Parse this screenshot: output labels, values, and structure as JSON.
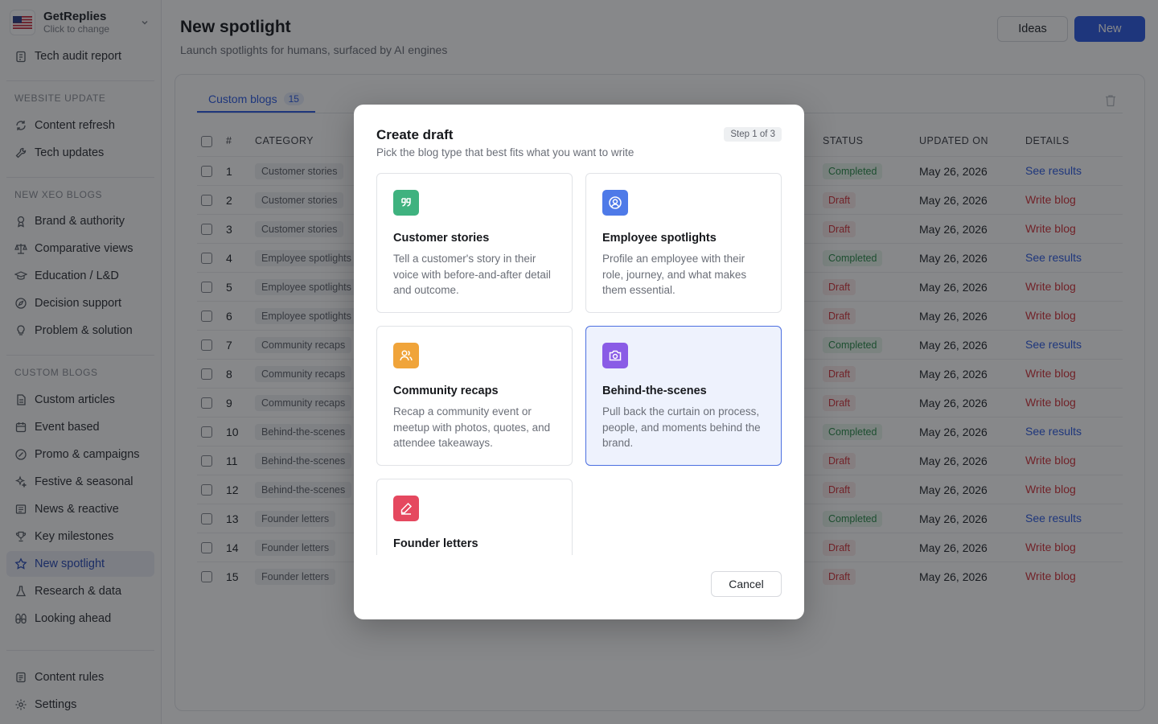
{
  "workspace": {
    "name": "GetReplies",
    "sub": "Click to change"
  },
  "sidebar": {
    "top_item": "Tech audit report",
    "sections": [
      {
        "title": "WEBSITE UPDATE",
        "items": [
          "Content refresh",
          "Tech updates"
        ]
      },
      {
        "title": "NEW XEO BLOGS",
        "items": [
          "Brand & authority",
          "Comparative views",
          "Education / L&D",
          "Decision support",
          "Problem & solution"
        ]
      },
      {
        "title": "CUSTOM BLOGS",
        "items": [
          "Custom articles",
          "Event based",
          "Promo & campaigns",
          "Festive & seasonal",
          "News & reactive",
          "Key milestones",
          "New spotlight",
          "Research & data",
          "Looking ahead"
        ]
      }
    ],
    "footer": [
      "Content rules",
      "Settings"
    ],
    "active": "New spotlight"
  },
  "header": {
    "title": "New spotlight",
    "subtitle": "Launch spotlights for humans, surfaced by AI engines",
    "ideas_label": "Ideas",
    "new_label": "New"
  },
  "tabs": [
    {
      "label": "Custom blogs",
      "count": "15"
    }
  ],
  "table": {
    "columns": {
      "num": "#",
      "category": "CATEGORY",
      "status": "STATUS",
      "updated": "UPDATED ON",
      "details": "DETAILS"
    },
    "rows": [
      {
        "n": "1",
        "category": "Customer stories",
        "status": "Completed",
        "updated": "May 26, 2026",
        "details": "See results"
      },
      {
        "n": "2",
        "category": "Customer stories",
        "status": "Draft",
        "updated": "May 26, 2026",
        "details": "Write blog"
      },
      {
        "n": "3",
        "category": "Customer stories",
        "status": "Draft",
        "updated": "May 26, 2026",
        "details": "Write blog"
      },
      {
        "n": "4",
        "category": "Employee spotlights",
        "status": "Completed",
        "updated": "May 26, 2026",
        "details": "See results"
      },
      {
        "n": "5",
        "category": "Employee spotlights",
        "status": "Draft",
        "updated": "May 26, 2026",
        "details": "Write blog"
      },
      {
        "n": "6",
        "category": "Employee spotlights",
        "status": "Draft",
        "updated": "May 26, 2026",
        "details": "Write blog"
      },
      {
        "n": "7",
        "category": "Community recaps",
        "status": "Completed",
        "updated": "May 26, 2026",
        "details": "See results"
      },
      {
        "n": "8",
        "category": "Community recaps",
        "status": "Draft",
        "updated": "May 26, 2026",
        "details": "Write blog"
      },
      {
        "n": "9",
        "category": "Community recaps",
        "status": "Draft",
        "updated": "May 26, 2026",
        "details": "Write blog"
      },
      {
        "n": "10",
        "category": "Behind-the-scenes",
        "status": "Completed",
        "updated": "May 26, 2026",
        "details": "See results"
      },
      {
        "n": "11",
        "category": "Behind-the-scenes",
        "status": "Draft",
        "updated": "May 26, 2026",
        "details": "Write blog"
      },
      {
        "n": "12",
        "category": "Behind-the-scenes",
        "status": "Draft",
        "updated": "May 26, 2026",
        "details": "Write blog"
      },
      {
        "n": "13",
        "category": "Founder letters",
        "status": "Completed",
        "updated": "May 26, 2026",
        "details": "See results"
      },
      {
        "n": "14",
        "category": "Founder letters",
        "status": "Draft",
        "updated": "May 26, 2026",
        "details": "Write blog"
      },
      {
        "n": "15",
        "category": "Founder letters",
        "status": "Draft",
        "updated": "May 26, 2026",
        "details": "Write blog"
      }
    ]
  },
  "modal": {
    "title": "Create draft",
    "subtitle": "Pick the blog type that best fits what you want to write",
    "step": "Step 1 of 3",
    "options": [
      {
        "title": "Customer stories",
        "desc": "Tell a customer's story in their voice with before-and-after detail and outcome.",
        "icon": "quote-icon",
        "color": "#3fb27f"
      },
      {
        "title": "Employee spotlights",
        "desc": "Profile an employee with their role, journey, and what makes them essential.",
        "icon": "user-circle-icon",
        "color": "#4e7ae8"
      },
      {
        "title": "Community recaps",
        "desc": "Recap a community event or meetup with photos, quotes, and attendee takeaways.",
        "icon": "users-icon",
        "color": "#f0a43a"
      },
      {
        "title": "Behind-the-scenes",
        "desc": "Pull back the curtain on process, people, and moments behind the brand.",
        "icon": "camera-icon",
        "color": "#8a5ce6"
      },
      {
        "title": "Founder letters",
        "desc": "",
        "icon": "pen-icon",
        "color": "#e5485f"
      }
    ],
    "selected": "Behind-the-scenes",
    "cancel_label": "Cancel"
  }
}
